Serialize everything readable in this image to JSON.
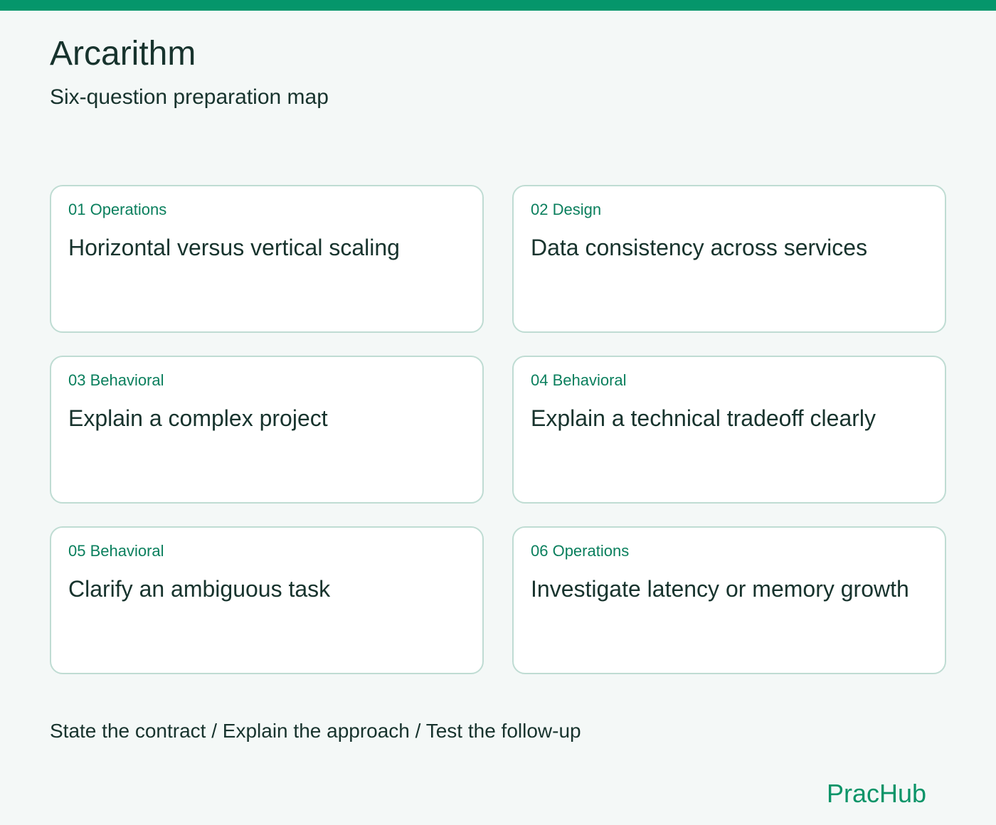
{
  "header": {
    "title": "Arcarithm",
    "subtitle": "Six-question preparation map"
  },
  "cards": [
    {
      "tag": "01 Operations",
      "title": "Horizontal versus vertical scaling"
    },
    {
      "tag": "02 Design",
      "title": "Data consistency across services"
    },
    {
      "tag": "03 Behavioral",
      "title": "Explain a complex project"
    },
    {
      "tag": "04 Behavioral",
      "title": "Explain a technical tradeoff clearly"
    },
    {
      "tag": "05 Behavioral",
      "title": "Clarify an ambiguous task"
    },
    {
      "tag": "06 Operations",
      "title": "Investigate latency or memory growth"
    }
  ],
  "footer": {
    "steps": "State the contract / Explain the approach / Test the follow-up",
    "brand": "PracHub"
  },
  "colors": {
    "accent": "#05966b",
    "background": "#f4f8f7",
    "card_border": "#bfdcd3",
    "text": "#17332d"
  }
}
